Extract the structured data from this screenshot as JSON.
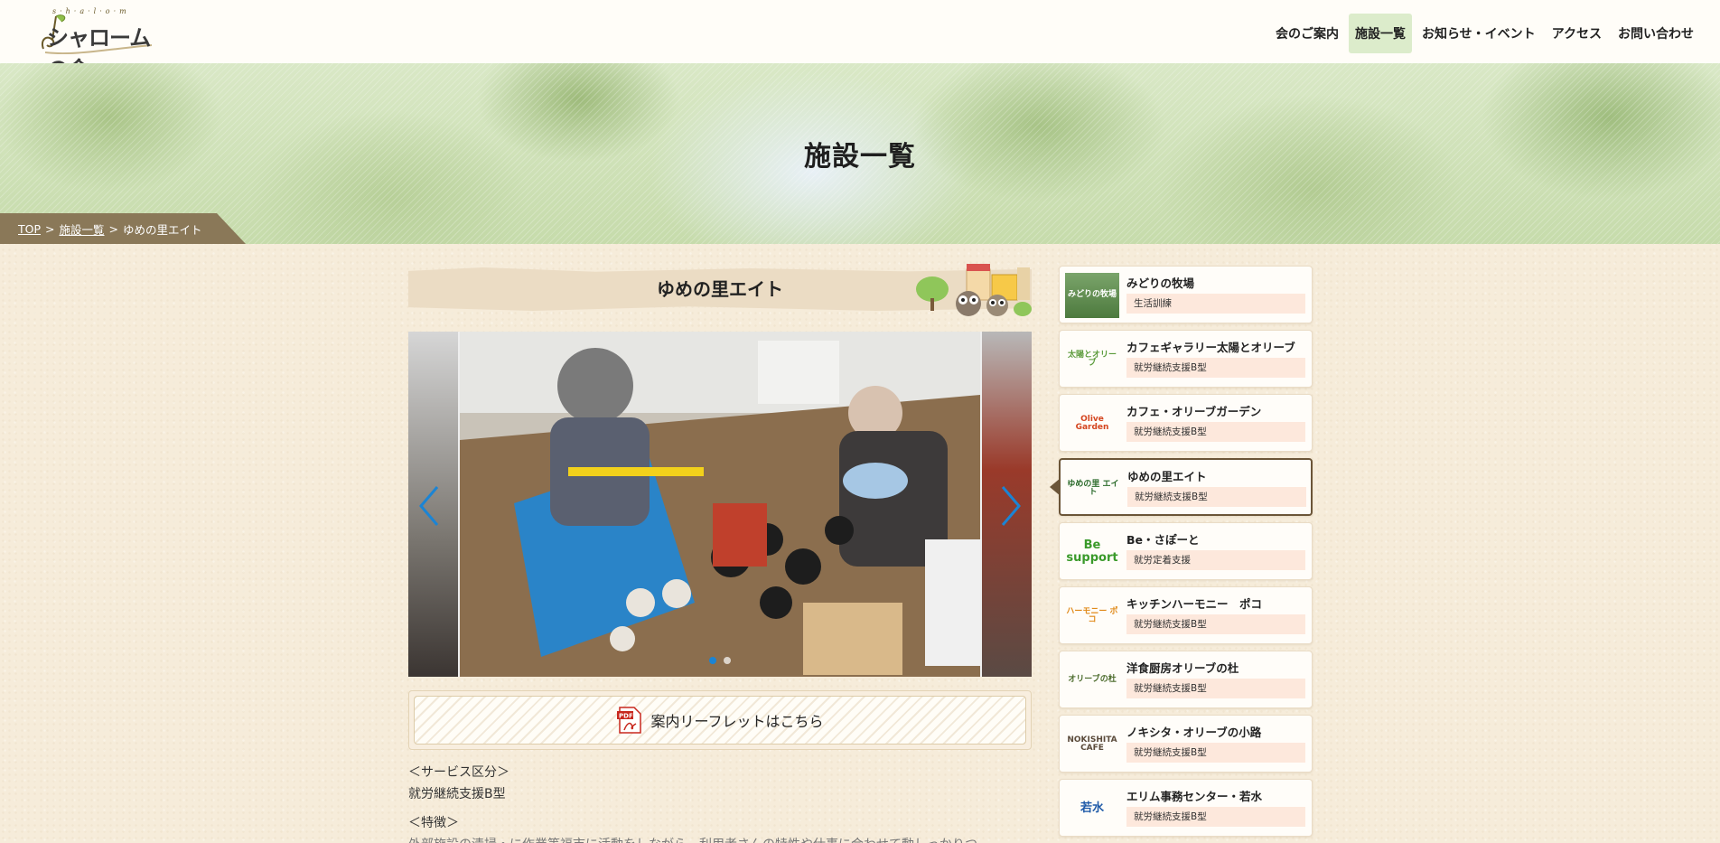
{
  "header": {
    "logo": {
      "romaji": "s·h·a·l·o·m",
      "text": "シャロームの会"
    },
    "nav": [
      {
        "label": "会のご案内",
        "active": false
      },
      {
        "label": "施設一覧",
        "active": true
      },
      {
        "label": "お知らせ・イベント",
        "active": false
      },
      {
        "label": "アクセス",
        "active": false
      },
      {
        "label": "お問い合わせ",
        "active": false
      }
    ]
  },
  "hero": {
    "title": "施設一覧"
  },
  "breadcrumb": {
    "top": "TOP",
    "sep1": ">",
    "list": "施設一覧",
    "sep2": ">",
    "current": "ゆめの里エイト"
  },
  "main": {
    "title": "ゆめの里エイト",
    "carousel": {
      "slide_count": 3,
      "active_slide": 1
    },
    "leaflet_label": "案内リーフレットはこちら",
    "service_heading": "＜サービス区分＞",
    "service_value": "就労継続支援B型",
    "feature_heading": "＜特徴＞",
    "feature_text": "外部施設の清掃・に作業等福市に活動をしながら、利用者さんの特性や仕事に合わせて動しっかりつ"
  },
  "sidebar": {
    "items": [
      {
        "name": "みどりの牧場",
        "tag": "生活訓練",
        "thumb": "みどりの牧場",
        "active": false
      },
      {
        "name": "カフェギャラリー太陽とオリーブ",
        "tag": "就労継続支援B型",
        "thumb": "太陽とオリーブ",
        "active": false
      },
      {
        "name": "カフェ・オリーブガーデン",
        "tag": "就労継続支援B型",
        "thumb": "Olive Garden",
        "active": false
      },
      {
        "name": "ゆめの里エイト",
        "tag": "就労継続支援B型",
        "thumb": "ゆめの里 エイト",
        "active": true
      },
      {
        "name": "Be・さぽーと",
        "tag": "就労定着支援",
        "thumb": "Be support",
        "active": false
      },
      {
        "name": "キッチンハーモニー　ポコ",
        "tag": "就労継続支援B型",
        "thumb": "ハーモニー ポコ",
        "active": false
      },
      {
        "name": "洋食厨房オリーブの杜",
        "tag": "就労継続支援B型",
        "thumb": "オリーブの杜",
        "active": false
      },
      {
        "name": "ノキシタ・オリーブの小路",
        "tag": "就労継続支援B型",
        "thumb": "NOKISHITA CAFE",
        "active": false
      },
      {
        "name": "エリム事務センター・若水",
        "tag": "就労継続支援B型",
        "thumb": "若水",
        "active": false
      }
    ]
  },
  "colors": {
    "page_bg": "#f6ecda",
    "nav_active": "#dceccb",
    "breadcrumb_bg": "#8a7858",
    "tag_bg": "#fde8dc",
    "active_border": "#6b5538",
    "carousel_dot_active": "#1b84d4"
  },
  "icons": [
    "logo-icon",
    "chevron-left-icon",
    "chevron-right-icon",
    "pdf-icon"
  ]
}
